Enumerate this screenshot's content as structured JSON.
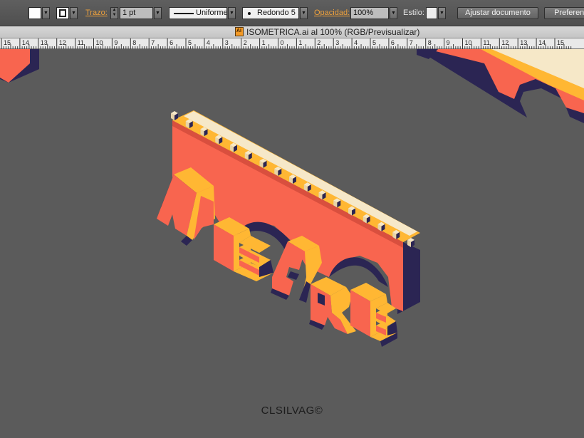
{
  "control_bar": {
    "stroke_label": "Trazo:",
    "stroke_weight": "1 pt",
    "profile_label": "Uniforme",
    "brush_label": "Redondo 5 ...",
    "opacity_label": "Opacidad:",
    "opacity_value": "100%",
    "style_label": "Estilo:",
    "fit_document_button": "Ajustar documento",
    "preferences_button": "Preferencias",
    "colors": {
      "fill": "#ffffff",
      "stroke": "#ffffff",
      "style": "#eeeeee",
      "label_accent": "#f0a23c"
    }
  },
  "document": {
    "tab_title": "ISOMETRICA.ai al 100% (RGB/Previsualizar)",
    "icon": "illustrator-file-icon"
  },
  "ruler": {
    "labels": [
      "15",
      "14",
      "13",
      "12",
      "11",
      "10",
      "9",
      "8",
      "7",
      "6",
      "5",
      "4",
      "3",
      "2",
      "1",
      "0",
      "1",
      "2",
      "3",
      "4",
      "5",
      "6",
      "7",
      "8",
      "9",
      "10",
      "11",
      "12",
      "13",
      "14",
      "15"
    ]
  },
  "artwork": {
    "lettering": "WE ARE",
    "signature": "CLSILVAG©",
    "colors": {
      "background": "#5b5b5b",
      "bridge_face": "#f8654f",
      "bridge_top": "#ffb733",
      "shadow": "#2b2553",
      "crenellation": "#f6e8c8",
      "ruler": "#e9e9e9"
    }
  }
}
